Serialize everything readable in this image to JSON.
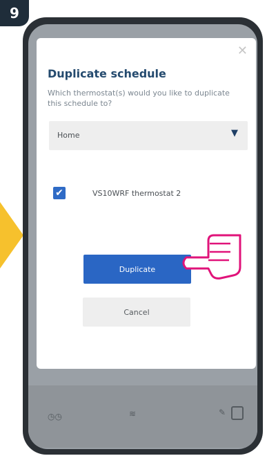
{
  "step": {
    "number": "9"
  },
  "dialog": {
    "close_icon": "close-icon",
    "title": "Duplicate schedule",
    "subtitle": "Which thermostat(s) would you like to duplicate this schedule to?",
    "location_select": {
      "value": "Home",
      "icon": "dropdown-triangle-icon"
    },
    "thermostats": [
      {
        "label": "VS10WRF thermostat 2",
        "checked": true
      }
    ],
    "duplicate_button": "Duplicate",
    "cancel_button": "Cancel"
  },
  "colors": {
    "primary": "#2a66c4",
    "title": "#244a6e",
    "badge": "#1f2d3a",
    "accent_arrow": "#f6c12d",
    "pointer_hand": "#e0137a"
  }
}
